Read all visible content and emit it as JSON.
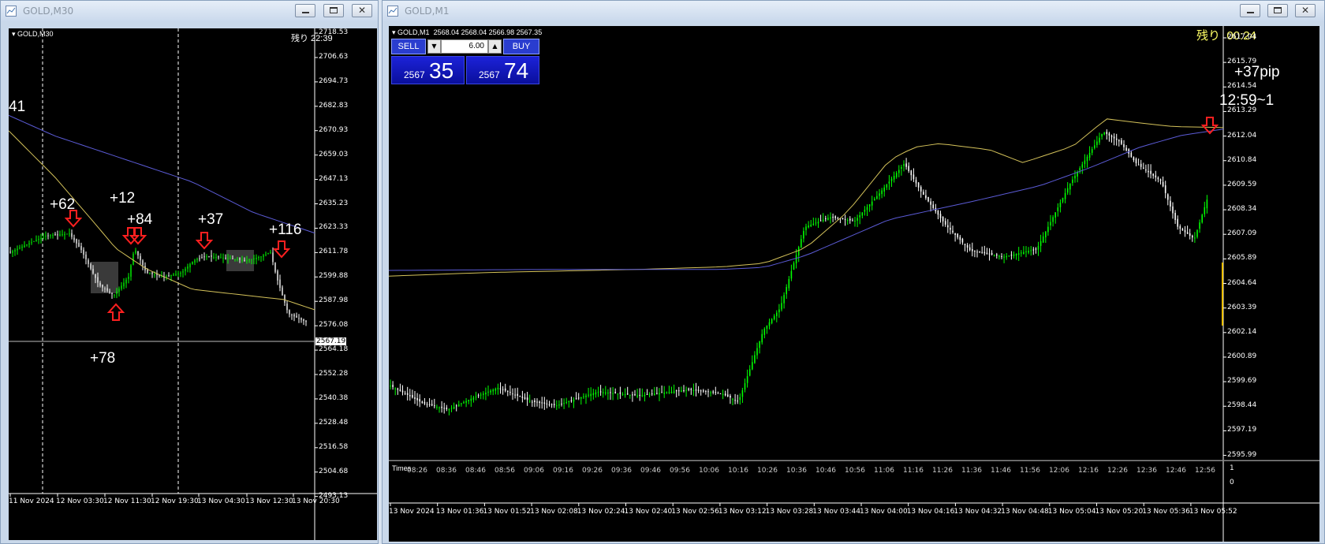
{
  "left_window": {
    "title": "GOLD,M30",
    "chart_symbol": "GOLD,M30",
    "countdown": "残り 22:39",
    "price_ticks": [
      "2718.53",
      "2706.63",
      "2694.73",
      "2682.83",
      "2670.93",
      "2659.03",
      "2647.13",
      "2635.23",
      "2623.33",
      "2611.78",
      "2599.88",
      "2587.98",
      "2576.08",
      "2564.18",
      "2552.28",
      "2540.38",
      "2528.48",
      "2516.58",
      "2504.68",
      "2493.13"
    ],
    "current_price": "2567.19",
    "time_ticks": [
      "11 Nov 2024",
      "12 Nov 03:30",
      "12 Nov 11:30",
      "12 Nov 19:30",
      "13 Nov 04:30",
      "13 Nov 12:30",
      "13 Nov 20:30"
    ],
    "annotations": [
      "41",
      "+62",
      "+12",
      "+84",
      "+37",
      "+116",
      "+78"
    ]
  },
  "right_window": {
    "title": "GOLD,M1",
    "chart_symbol": "GOLD,M1",
    "ohlc": "2568.04 2568.04 2566.98 2567.35",
    "countdown_label": "残り",
    "countdown_value": "00:24",
    "trade_panel": {
      "sell_label": "SELL",
      "buy_label": "BUY",
      "lot": "6.00",
      "sell_price_prefix": "2567",
      "sell_price_big": "35",
      "buy_price_prefix": "2567",
      "buy_price_big": "74"
    },
    "annotations": {
      "pips": "+37pip",
      "time_range": "12:59~1"
    },
    "price_ticks": [
      "2617.04",
      "2615.79",
      "2614.54",
      "2613.29",
      "2612.04",
      "2610.84",
      "2609.59",
      "2608.34",
      "2607.09",
      "2605.89",
      "2604.64",
      "2603.39",
      "2602.14",
      "2600.89",
      "2599.69",
      "2598.44",
      "2597.19",
      "2595.99"
    ],
    "indicator_title": "Times",
    "indicator_ticks": [
      "1",
      "0"
    ],
    "indicator_time_ticks": [
      "08:26",
      "08:36",
      "08:46",
      "08:56",
      "09:06",
      "09:16",
      "09:26",
      "09:36",
      "09:46",
      "09:56",
      "10:06",
      "10:16",
      "10:26",
      "10:36",
      "10:46",
      "10:56",
      "11:06",
      "11:16",
      "11:26",
      "11:36",
      "11:46",
      "11:56",
      "12:06",
      "12:16",
      "12:26",
      "12:36",
      "12:46",
      "12:56"
    ],
    "time_ticks": [
      "13 Nov 2024",
      "13 Nov 01:36",
      "13 Nov 01:52",
      "13 Nov 02:08",
      "13 Nov 02:24",
      "13 Nov 02:40",
      "13 Nov 02:56",
      "13 Nov 03:12",
      "13 Nov 03:28",
      "13 Nov 03:44",
      "13 Nov 04:00",
      "13 Nov 04:16",
      "13 Nov 04:32",
      "13 Nov 04:48",
      "13 Nov 05:04",
      "13 Nov 05:20",
      "13 Nov 05:36",
      "13 Nov 05:52"
    ]
  },
  "colors": {
    "bull": "#00ff00",
    "bear": "#ffffff",
    "ma_fast": "#d4c25a",
    "ma_slow": "#5b5bd6",
    "arrow": "#ff2020",
    "countdown": "#ffff66"
  }
}
